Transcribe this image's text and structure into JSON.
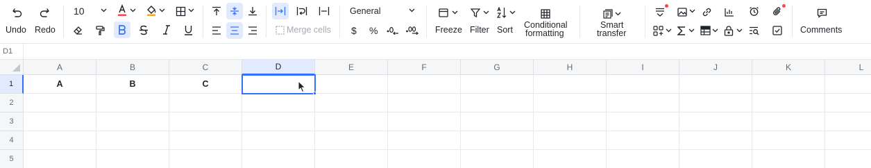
{
  "toolbar": {
    "undo": "Undo",
    "redo": "Redo",
    "font_size": "10",
    "merge_cells": "Merge cells",
    "number_format": "General",
    "currency": "$",
    "percent": "%",
    "freeze": "Freeze",
    "filter": "Filter",
    "sort": "Sort",
    "conditional_formatting_1": "Conditional",
    "conditional_formatting_2": "formatting",
    "smart_transfer_1": "Smart",
    "smart_transfer_2": "transfer",
    "comments": "Comments",
    "accent": "#3370ff",
    "text_color_bar": "#f54a45",
    "fill_color_bar": "#f5a623"
  },
  "formula_bar": {
    "cell_ref": "D1"
  },
  "grid": {
    "columns": [
      "A",
      "B",
      "C",
      "D",
      "E",
      "F",
      "G",
      "H",
      "I",
      "J",
      "K",
      "L"
    ],
    "rows": [
      "1",
      "2",
      "3",
      "4",
      "5"
    ],
    "active_column": "D",
    "active_row": "1",
    "cells": {
      "A1": "A",
      "B1": "B",
      "C1": "C"
    }
  }
}
